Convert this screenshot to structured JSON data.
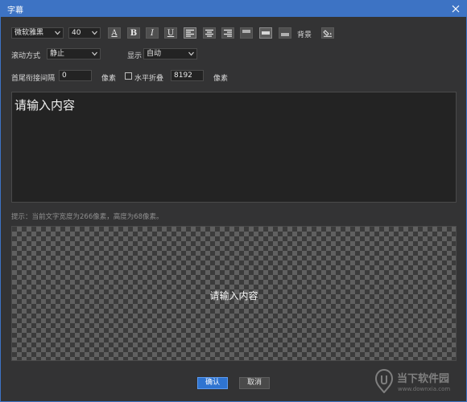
{
  "window": {
    "title": "字幕"
  },
  "toolbar": {
    "font": "微软雅黑",
    "size": "40",
    "buttons": [
      {
        "name": "font-color",
        "glyph": "A"
      },
      {
        "name": "bold",
        "glyph": "B"
      },
      {
        "name": "italic",
        "glyph": "I"
      },
      {
        "name": "underline",
        "glyph": "U"
      }
    ],
    "background_label": "背景"
  },
  "scroll": {
    "label": "滚动方式",
    "value": "静止",
    "display_label": "显示",
    "display_value": "自动"
  },
  "spacing": {
    "label": "首尾衔接间隔",
    "value": "0",
    "unit": "像素",
    "fold_label": "水平折叠",
    "fold_value": "8192",
    "fold_unit": "像素",
    "fold_checked": false
  },
  "editor": {
    "content": "请输入内容"
  },
  "hint": "提示：当前文字宽度为266像素，高度为68像素。",
  "preview": {
    "text": "请输入内容"
  },
  "footer": {
    "ok": "确认",
    "cancel": "取消"
  },
  "watermark": {
    "text": "当下软件园",
    "url": "www.downxia.com"
  }
}
